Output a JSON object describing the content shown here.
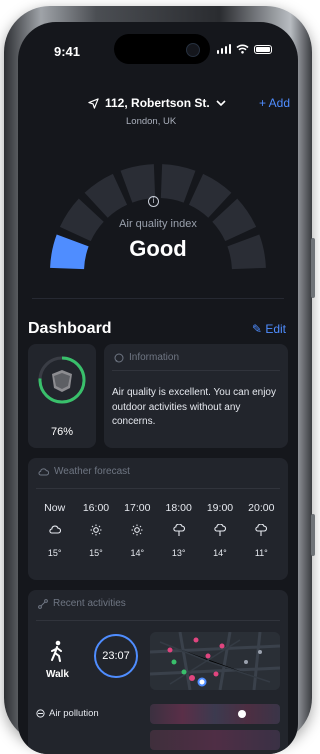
{
  "status": {
    "time": "9:41"
  },
  "location": {
    "street": "112, Robertson St.",
    "city": "London, UK",
    "add_label": "+ Add"
  },
  "aqi": {
    "label": "Air quality index",
    "value": "Good",
    "segments_total": 8,
    "segments_active": 1
  },
  "dashboard": {
    "title": "Dashboard",
    "edit_label": "Edit"
  },
  "score": {
    "percent": "76%",
    "fraction": 0.76
  },
  "information": {
    "title": "Information",
    "text": "Air quality is excellent. You can enjoy outdoor activities without any concerns."
  },
  "forecast": {
    "title": "Weather forecast",
    "hours": [
      {
        "time": "Now",
        "icon": "cloud-icon",
        "temp": "15°"
      },
      {
        "time": "16:00",
        "icon": "sun-icon",
        "temp": "15°"
      },
      {
        "time": "17:00",
        "icon": "sun-icon",
        "temp": "14°"
      },
      {
        "time": "18:00",
        "icon": "rain-icon",
        "temp": "13°"
      },
      {
        "time": "19:00",
        "icon": "rain-icon",
        "temp": "14°"
      },
      {
        "time": "20:00",
        "icon": "rain-icon",
        "temp": "11°"
      }
    ]
  },
  "activities": {
    "title": "Recent activities",
    "activity": "Walk",
    "duration": "23:07",
    "pollution_label": "Air pollution"
  },
  "colors": {
    "accent": "#4f8dff",
    "background": "#15171c",
    "card": "#22252c",
    "ring": "#39c06b"
  }
}
